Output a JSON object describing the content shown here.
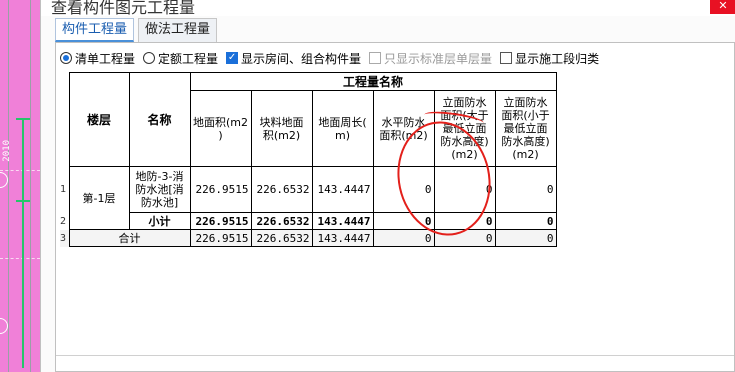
{
  "window": {
    "title": "查看构件图元工程量",
    "close_glyph": "✕"
  },
  "tabs": [
    {
      "label": "构件工程量",
      "active": true
    },
    {
      "label": "做法工程量",
      "active": false
    }
  ],
  "options": {
    "radio_list": "清单工程量",
    "radio_quota": "定额工程量",
    "check_show_rooms": "显示房间、组合构件量",
    "check_standard_floor": "只显示标准层单层量",
    "check_construction": "显示施工段归类"
  },
  "cad": {
    "dimension": "2010"
  },
  "table": {
    "header_group": "工程量名称",
    "col_floor": "楼层",
    "col_name": "名称",
    "columns": [
      "地面积(m2)",
      "块料地面积(m2)",
      "地面周长(m)",
      "水平防水面积(m2)",
      "立面防水面积(大于最低立面防水高度)(m2)",
      "立面防水面积(小于最低立面防水高度)(m2)"
    ],
    "col_labels": [
      [
        "地面积(m2",
        ")"
      ],
      [
        "块料地面",
        "积(m2)"
      ],
      [
        "地面周长(",
        "m)"
      ],
      [
        "水平防水",
        "面积(m2)"
      ],
      [
        "立面防水",
        "面积(大于",
        "最低立面",
        "防水高度)",
        "(m2)"
      ],
      [
        "立面防水",
        "面积(小于",
        "最低立面",
        "防水高度)",
        "(m2)"
      ]
    ],
    "row_numbers": [
      "1",
      "2",
      "3"
    ],
    "rows": [
      {
        "floor": "第-1层",
        "name_lines": [
          "地防-3-消",
          "防水池[消",
          "防水池]"
        ],
        "values": [
          "226.9515",
          "226.6532",
          "143.4447",
          "0",
          "0",
          "0"
        ]
      },
      {
        "label": "小计",
        "values": [
          "226.9515",
          "226.6532",
          "143.4447",
          "0",
          "0",
          "0"
        ]
      },
      {
        "label": "合计",
        "values": [
          "226.9515",
          "226.6532",
          "143.4447",
          "0",
          "0",
          "0"
        ]
      }
    ]
  },
  "colors": {
    "accent": "#1a6fd9",
    "annotation": "#e3201b",
    "cad_background": "#f080d8"
  }
}
